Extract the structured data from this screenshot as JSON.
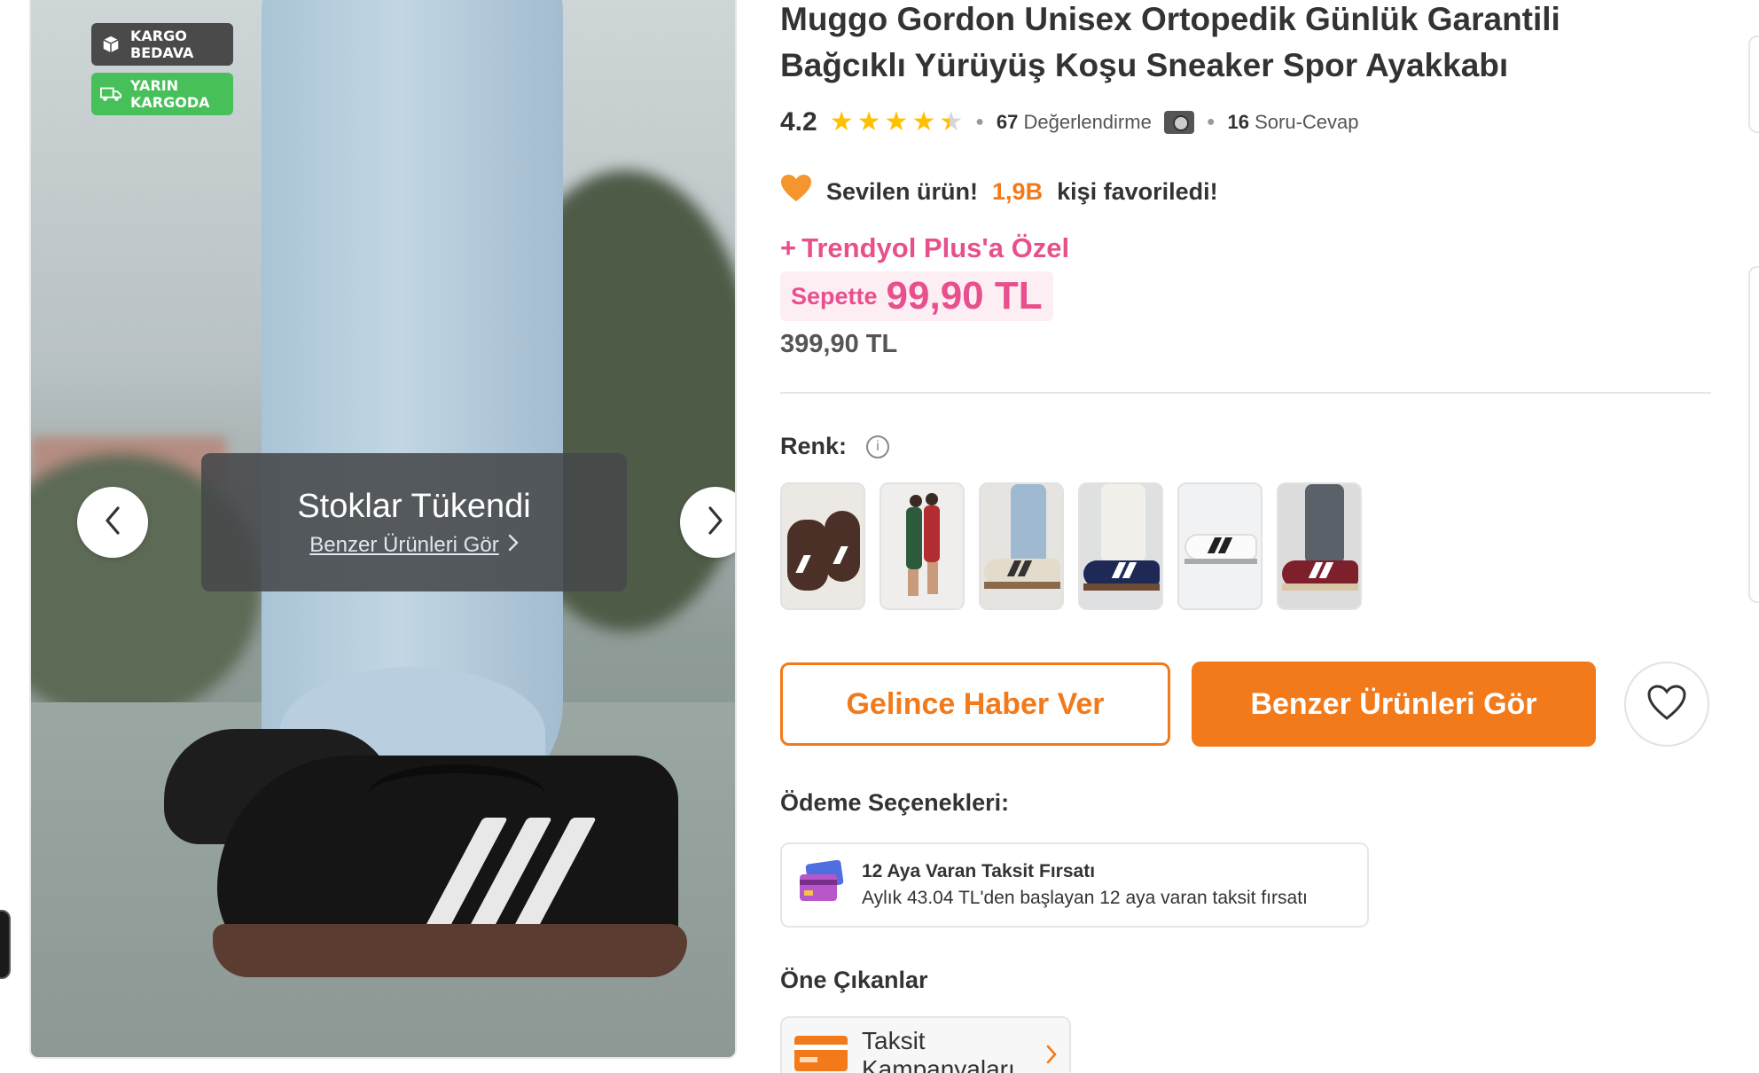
{
  "gallery": {
    "badges": [
      {
        "line1": "KARGO",
        "line2": "BEDAVA",
        "icon": "box-icon",
        "color": "#4a4a4a"
      },
      {
        "line1": "YARIN",
        "line2": "KARGODA",
        "icon": "truck-icon",
        "color": "#47c05a"
      }
    ],
    "stock_overlay": {
      "title": "Stoklar Tükendi",
      "link": "Benzer Ürünleri Gör"
    }
  },
  "product": {
    "brand": "Muggo",
    "name": "Gordon Unisex Ortopedik Günlük Garantili Bağcıklı Yürüyüş Koşu Sneaker Spor Ayakkabı",
    "rating": "4.2",
    "rating_stars": 4.2,
    "review_count": "67",
    "review_label": "Değerlendirme",
    "qa_count": "16",
    "qa_label": "Soru-Cevap",
    "favorite": {
      "prefix": "Sevilen ürün!",
      "count": "1,9B",
      "suffix": "kişi favoriledi!"
    },
    "plus_label": "Trendyol Plus'a Özel",
    "plus_symbol": "+",
    "price_label": "Sepette",
    "price": "99,90 TL",
    "old_price": "399,90 TL"
  },
  "color_section": {
    "label": "Renk:",
    "swatches": [
      {
        "name": "brown"
      },
      {
        "name": "people"
      },
      {
        "name": "beige"
      },
      {
        "name": "navy"
      },
      {
        "name": "white"
      },
      {
        "name": "burgundy"
      }
    ]
  },
  "actions": {
    "notify_label": "Gelince Haber Ver",
    "similar_label": "Benzer Ürünleri Gör"
  },
  "payment": {
    "label": "Ödeme Seçenekleri:",
    "card_title": "12 Aya Varan Taksit Fırsatı",
    "card_desc": "Aylık 43.04 TL'den başlayan 12 aya varan taksit fırsatı"
  },
  "highlights": {
    "label": "Öne Çıkanlar",
    "card_text": "Taksit Kampanyaları"
  },
  "colors": {
    "accent": "#f27a1a",
    "plus_pink": "#e8508d",
    "star": "#ffc000",
    "green_badge": "#47c05a"
  }
}
